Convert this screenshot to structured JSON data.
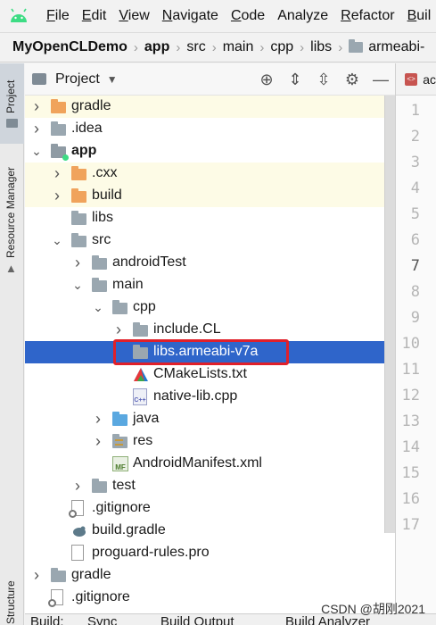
{
  "menubar": {
    "items": [
      {
        "mnemonic": "F",
        "rest": "ile"
      },
      {
        "mnemonic": "E",
        "rest": "dit"
      },
      {
        "mnemonic": "V",
        "rest": "iew"
      },
      {
        "mnemonic": "N",
        "rest": "avigate"
      },
      {
        "mnemonic": "C",
        "rest": "ode"
      },
      {
        "mnemonic": "",
        "rest": "Analyze"
      },
      {
        "mnemonic": "R",
        "rest": "efactor"
      },
      {
        "mnemonic": "B",
        "rest": "uil"
      }
    ]
  },
  "breadcrumb": [
    "MyOpenCLDemo",
    "app",
    "src",
    "main",
    "cpp",
    "libs",
    "armeabi-"
  ],
  "left_strip": {
    "project": "Project",
    "resource_manager": "Resource Manager",
    "structure": "Structure"
  },
  "panel": {
    "title": "Project",
    "dropdown": "▼",
    "icons": [
      "target-icon",
      "expand-all-icon",
      "collapse-all-icon",
      "gear-icon",
      "minimize-icon"
    ]
  },
  "tree": [
    {
      "label": "gradle",
      "depth": 0,
      "arrow": "›",
      "icon": "orange",
      "alt": true
    },
    {
      "label": ".idea",
      "depth": 0,
      "arrow": "›",
      "icon": "gray"
    },
    {
      "label": "app",
      "depth": 0,
      "arrow": "⌄",
      "icon": "module",
      "bold": true
    },
    {
      "label": ".cxx",
      "depth": 1,
      "arrow": "›",
      "icon": "orange",
      "alt": true
    },
    {
      "label": "build",
      "depth": 1,
      "arrow": "›",
      "icon": "orange",
      "alt": true
    },
    {
      "label": "libs",
      "depth": 1,
      "arrow": "",
      "icon": "gray"
    },
    {
      "label": "src",
      "depth": 1,
      "arrow": "⌄",
      "icon": "gray"
    },
    {
      "label": "androidTest",
      "depth": 2,
      "arrow": "›",
      "icon": "gray"
    },
    {
      "label": "main",
      "depth": 2,
      "arrow": "⌄",
      "icon": "gray"
    },
    {
      "label": "cpp",
      "depth": 3,
      "arrow": "⌄",
      "icon": "gray"
    },
    {
      "label": "include.CL",
      "depth": 4,
      "arrow": "›",
      "icon": "gray"
    },
    {
      "label": "libs.armeabi-v7a",
      "depth": 4,
      "arrow": "",
      "icon": "gray",
      "selected": true
    },
    {
      "label": "CMakeLists.txt",
      "depth": 4,
      "arrow": "",
      "icon": "cmake"
    },
    {
      "label": "native-lib.cpp",
      "depth": 4,
      "arrow": "",
      "icon": "cpp"
    },
    {
      "label": "java",
      "depth": 3,
      "arrow": "›",
      "icon": "blue"
    },
    {
      "label": "res",
      "depth": 3,
      "arrow": "›",
      "icon": "res"
    },
    {
      "label": "AndroidManifest.xml",
      "depth": 3,
      "arrow": "",
      "icon": "manifest"
    },
    {
      "label": "test",
      "depth": 2,
      "arrow": "›",
      "icon": "gray"
    },
    {
      "label": ".gitignore",
      "depth": 1,
      "arrow": "",
      "icon": "gitignore"
    },
    {
      "label": "build.gradle",
      "depth": 1,
      "arrow": "",
      "icon": "gradlefile"
    },
    {
      "label": "proguard-rules.pro",
      "depth": 1,
      "arrow": "",
      "icon": "file"
    },
    {
      "label": "gradle",
      "depth": 0,
      "arrow": "›",
      "icon": "gray"
    },
    {
      "label": ".gitignore",
      "depth": 0,
      "arrow": "",
      "icon": "gitignore"
    }
  ],
  "editor": {
    "tab_label": "ac",
    "tab_badge": "<>",
    "line_numbers": [
      "1",
      "2",
      "3",
      "4",
      "5",
      "6",
      "7",
      "8",
      "9",
      "10",
      "11",
      "12",
      "13",
      "14",
      "15",
      "16",
      "17"
    ],
    "current_line": "7"
  },
  "bottom_tabs": [
    "Build:",
    "Sync",
    "Build Output",
    "Build Analyzer"
  ],
  "watermark": "CSDN @胡刚2021",
  "colors": {
    "selection": "#2f65ca",
    "highlight_box": "#e0202a",
    "folder_gray": "#9aa7b0",
    "folder_orange": "#f0a35c",
    "folder_blue": "#5aa8e0"
  }
}
